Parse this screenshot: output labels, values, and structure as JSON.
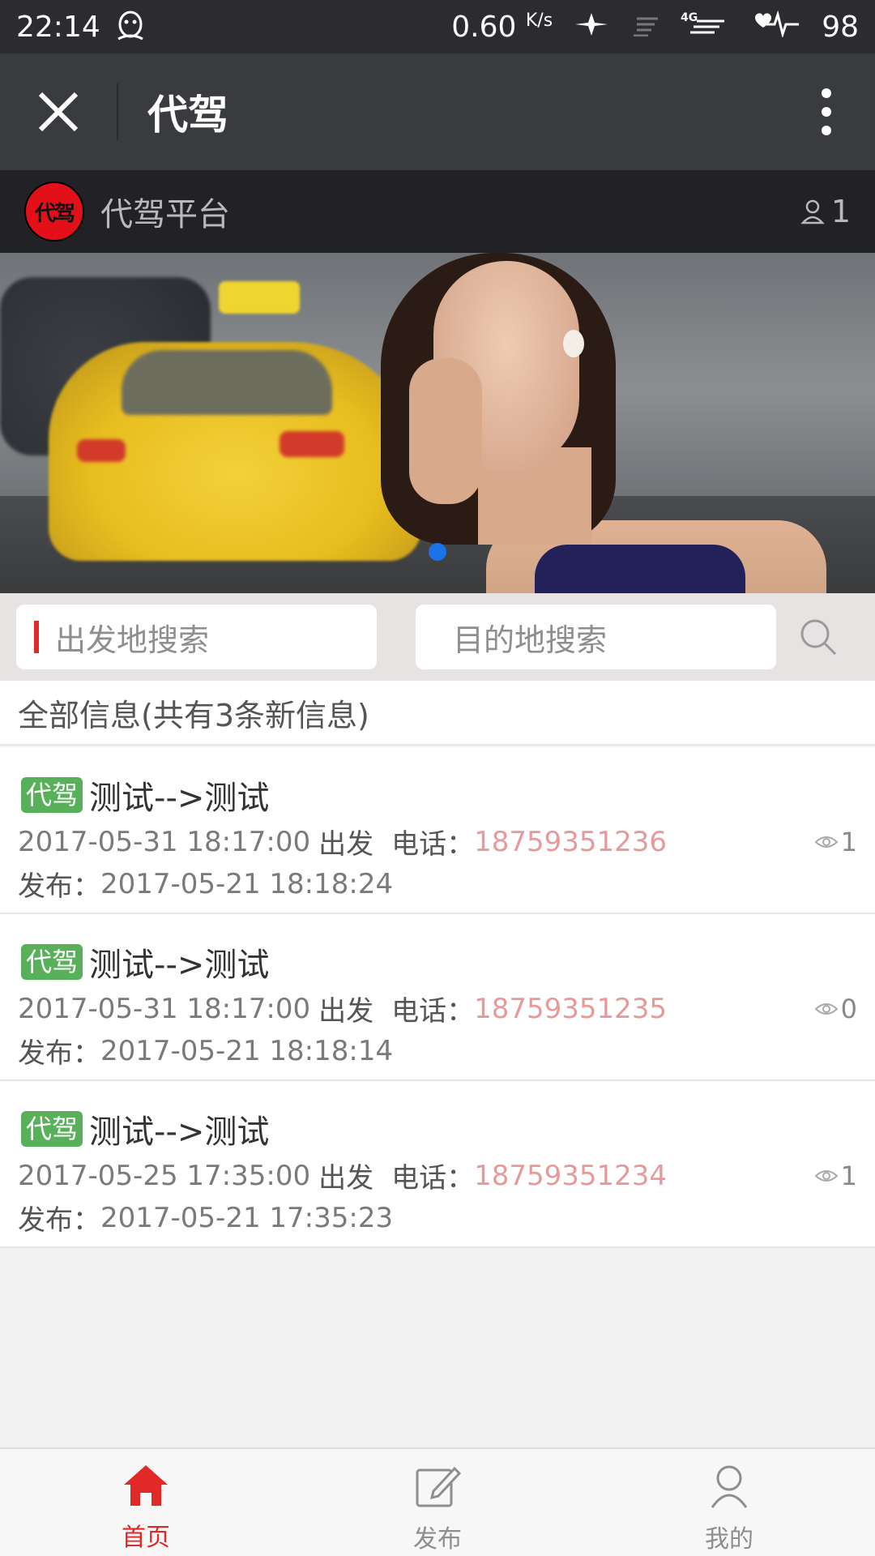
{
  "status_bar": {
    "time": "22:14",
    "net_speed": "0.60",
    "net_unit": "K/s",
    "signal": "4G",
    "battery": "98"
  },
  "title_bar": {
    "title": "代驾"
  },
  "account": {
    "avatar_text": "代驾",
    "name": "代驾平台",
    "online_count": "1"
  },
  "banner": {
    "active_slide": 1,
    "slide_count": 1
  },
  "search": {
    "from_placeholder": "出发地搜索",
    "to_placeholder": "目的地搜索"
  },
  "info_header": "全部信息(共有3条新信息)",
  "list": {
    "items": [
      {
        "tag": "代驾",
        "route": "测试-->测试",
        "depart_time": "2017-05-31 18:17:00",
        "depart_label": "出发",
        "phone_label": "电话：",
        "phone": "18759351236",
        "publish_label": "发布：",
        "publish_time": "2017-05-21 18:18:24",
        "views": "1"
      },
      {
        "tag": "代驾",
        "route": "测试-->测试",
        "depart_time": "2017-05-31 18:17:00",
        "depart_label": "出发",
        "phone_label": "电话：",
        "phone": "18759351235",
        "publish_label": "发布：",
        "publish_time": "2017-05-21 18:18:14",
        "views": "0"
      },
      {
        "tag": "代驾",
        "route": "测试-->测试",
        "depart_time": "2017-05-25 17:35:00",
        "depart_label": "出发",
        "phone_label": "电话：",
        "phone": "18759351234",
        "publish_label": "发布：",
        "publish_time": "2017-05-21 17:35:23",
        "views": "1"
      }
    ]
  },
  "tabs": [
    {
      "label": "首页",
      "icon": "home-icon",
      "active": true
    },
    {
      "label": "发布",
      "icon": "edit-icon",
      "active": false
    },
    {
      "label": "我的",
      "icon": "user-icon",
      "active": false
    }
  ],
  "colors": {
    "accent_red": "#e12a27",
    "tag_green": "#58b05a",
    "phone_pink": "#e79a9a",
    "banner_dot_blue": "#1a73e8"
  }
}
